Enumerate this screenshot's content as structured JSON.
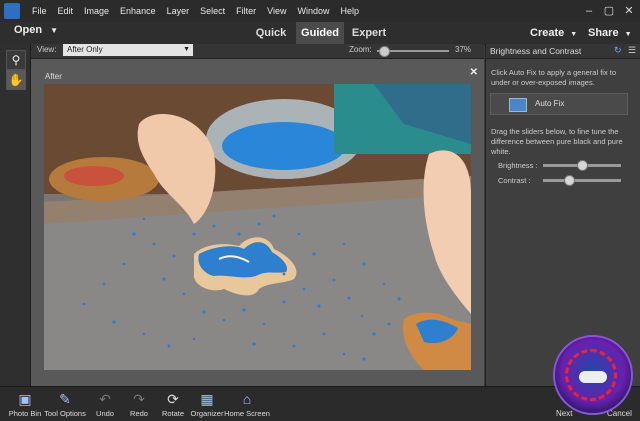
{
  "menu": [
    "File",
    "Edit",
    "Image",
    "Enhance",
    "Layer",
    "Select",
    "Filter",
    "View",
    "Window",
    "Help"
  ],
  "window_controls": [
    "–",
    "▢",
    "✕"
  ],
  "modebar": {
    "open": "Open",
    "tabs": [
      "Quick",
      "Guided",
      "Expert"
    ],
    "active_tab": "Guided",
    "create": "Create",
    "share": "Share"
  },
  "tools": {
    "zoom_icon": "magnifier-icon",
    "hand_icon": "hand-icon"
  },
  "options": {
    "view_label": "View:",
    "view_value": "After Only",
    "zoom_label": "Zoom:",
    "zoom_value": "37%",
    "zoom_fraction": 0.1
  },
  "canvas": {
    "label": "After",
    "close": "✕"
  },
  "panel": {
    "title": "Brightness and Contrast",
    "intro": "Click Auto Fix to apply a general fix to under or over-exposed images.",
    "autofix_label": "Auto Fix",
    "drag_text": "Drag the sliders below, to fine tune the difference between pure black and pure white.",
    "brightness_label": "Brightness :",
    "contrast_label": "Contrast :",
    "brightness_fraction": 0.5,
    "contrast_fraction": 0.33
  },
  "bottom": {
    "photo_bin": "Photo Bin",
    "tool_options": "Tool Options",
    "undo": "Undo",
    "redo": "Redo",
    "rotate": "Rotate",
    "organizer": "Organizer",
    "home_screen": "Home Screen",
    "next": "Next",
    "cancel": "Cancel"
  },
  "colors": {
    "accent": "#2f6fc1",
    "active_tab": "#4b4b4b",
    "sprinkles": "#2a7fd4"
  }
}
